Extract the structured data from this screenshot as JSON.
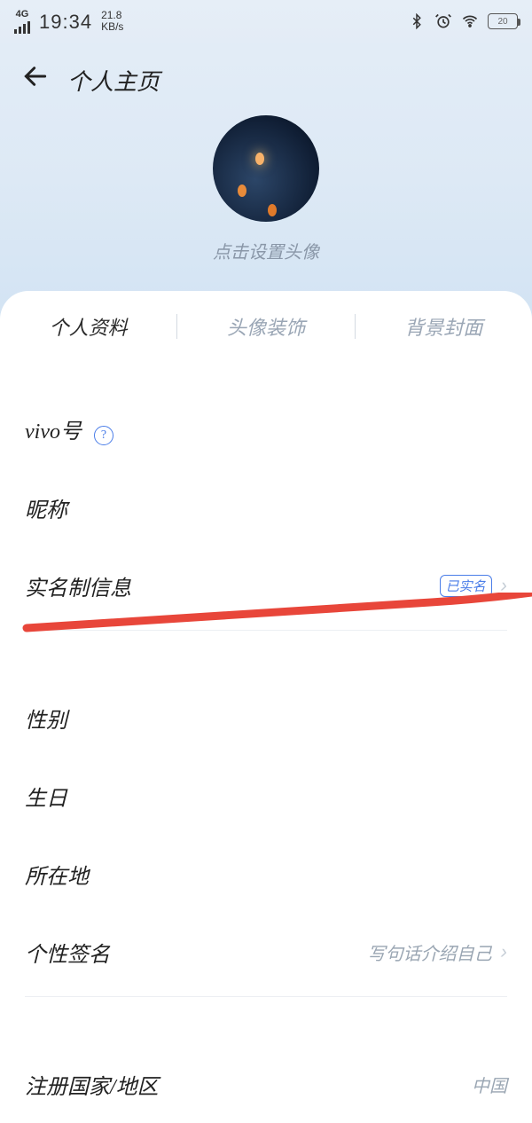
{
  "status": {
    "signal_label": "4G",
    "time": "19:34",
    "speed_top": "21.8",
    "speed_unit": "KB/s",
    "battery": "20"
  },
  "header": {
    "title": "个人主页",
    "avatar_hint": "点击设置头像"
  },
  "tabs": [
    {
      "label": "个人资料",
      "active": true
    },
    {
      "label": "头像装饰",
      "active": false
    },
    {
      "label": "背景封面",
      "active": false
    }
  ],
  "rows": {
    "vivo_label": "vivo号",
    "nickname_label": "昵称",
    "realname_label": "实名制信息",
    "realname_badge": "已实名",
    "gender_label": "性别",
    "birthday_label": "生日",
    "location_label": "所在地",
    "signature_label": "个性签名",
    "signature_placeholder": "写句话介绍自己",
    "region_label": "注册国家/地区",
    "region_value": "中国"
  }
}
